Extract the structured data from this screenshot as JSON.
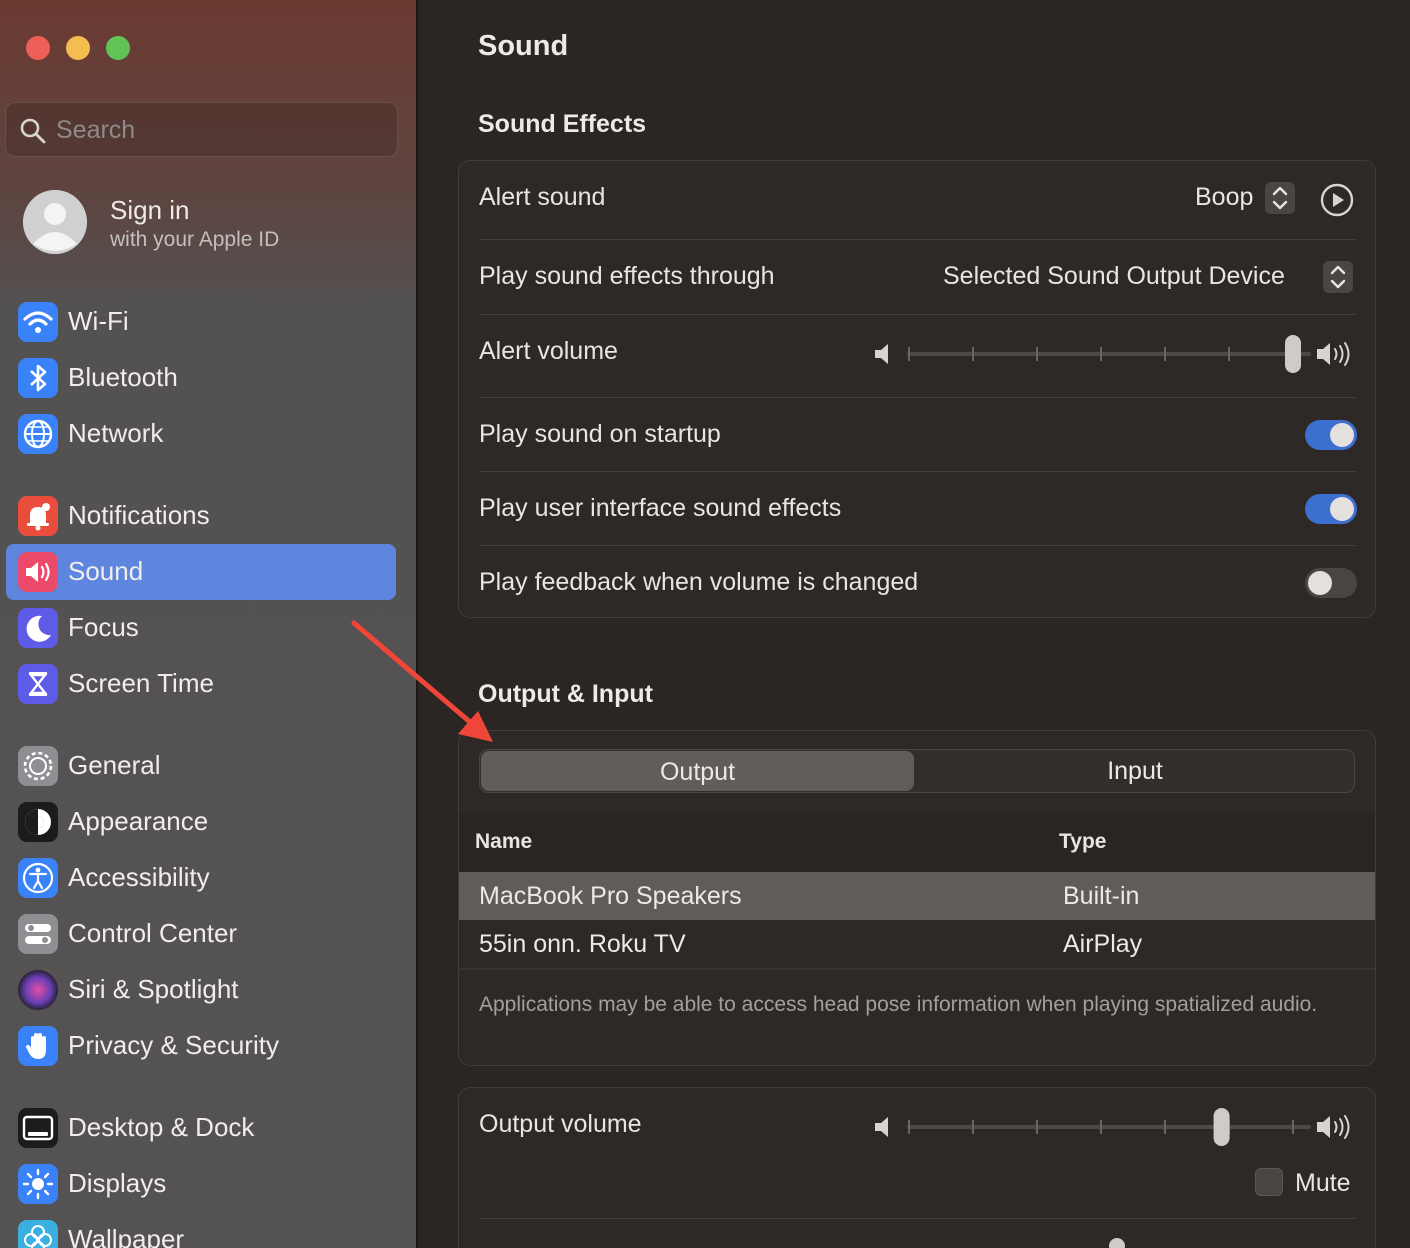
{
  "window": {
    "traffic_lights": {
      "close": "#ee5f57",
      "minimize": "#f4bd4f",
      "zoom": "#5fc454"
    }
  },
  "sidebar": {
    "search_placeholder": "Search",
    "account": {
      "name": "Sign in",
      "subtitle": "with your Apple ID"
    },
    "items": [
      {
        "label": "Wi-Fi",
        "icon": "wifi-icon",
        "color": "#3a82f7"
      },
      {
        "label": "Bluetooth",
        "icon": "bluetooth-icon",
        "color": "#3a82f7"
      },
      {
        "label": "Network",
        "icon": "globe-icon",
        "color": "#3a82f7"
      },
      {
        "label": "Notifications",
        "icon": "bell-icon",
        "color": "#eb4d3d"
      },
      {
        "label": "Sound",
        "icon": "speaker-icon",
        "color": "#eb4a6a"
      },
      {
        "label": "Focus",
        "icon": "moon-icon",
        "color": "#5e5ce6"
      },
      {
        "label": "Screen Time",
        "icon": "hourglass-icon",
        "color": "#5e5ce6"
      },
      {
        "label": "General",
        "icon": "gear-icon",
        "color": "#8e8e93"
      },
      {
        "label": "Appearance",
        "icon": "appearance-icon",
        "color": "#1c1c1e"
      },
      {
        "label": "Accessibility",
        "icon": "accessibility-icon",
        "color": "#3a82f7"
      },
      {
        "label": "Control Center",
        "icon": "control-center-icon",
        "color": "#8e8e93"
      },
      {
        "label": "Siri & Spotlight",
        "icon": "siri-icon",
        "color": "#6a3fb5"
      },
      {
        "label": "Privacy & Security",
        "icon": "hand-icon",
        "color": "#3a82f7"
      },
      {
        "label": "Desktop & Dock",
        "icon": "dock-icon",
        "color": "#1c1c1e"
      },
      {
        "label": "Displays",
        "icon": "sun-icon",
        "color": "#3a82f7"
      },
      {
        "label": "Wallpaper",
        "icon": "wallpaper-icon",
        "color": "#3ab0e0"
      }
    ],
    "active_item": "Sound"
  },
  "main": {
    "title": "Sound",
    "sound_effects": {
      "heading": "Sound Effects",
      "alert_sound_label": "Alert sound",
      "alert_sound_value": "Boop",
      "play_through_label": "Play sound effects through",
      "play_through_value": "Selected Sound Output Device",
      "alert_volume_label": "Alert volume",
      "alert_volume_level": 1.0,
      "startup_label": "Play sound on startup",
      "startup_on": true,
      "ui_sounds_label": "Play user interface sound effects",
      "ui_sounds_on": true,
      "feedback_label": "Play feedback when volume is changed",
      "feedback_on": false
    },
    "output_input": {
      "heading": "Output & Input",
      "tabs": [
        "Output",
        "Input"
      ],
      "selected_tab": "Output",
      "columns": [
        "Name",
        "Type"
      ],
      "devices": [
        {
          "name": "MacBook Pro Speakers",
          "type": "Built-in",
          "selected": true
        },
        {
          "name": "55in onn. Roku TV",
          "type": "AirPlay",
          "selected": false
        }
      ],
      "note": "Applications may be able to access head pose information when playing spatialized audio."
    },
    "output_volume": {
      "label": "Output volume",
      "level": 0.81,
      "mute_label": "Mute",
      "muted": false
    }
  },
  "annotation": {
    "arrow_color": "#f0463a"
  }
}
